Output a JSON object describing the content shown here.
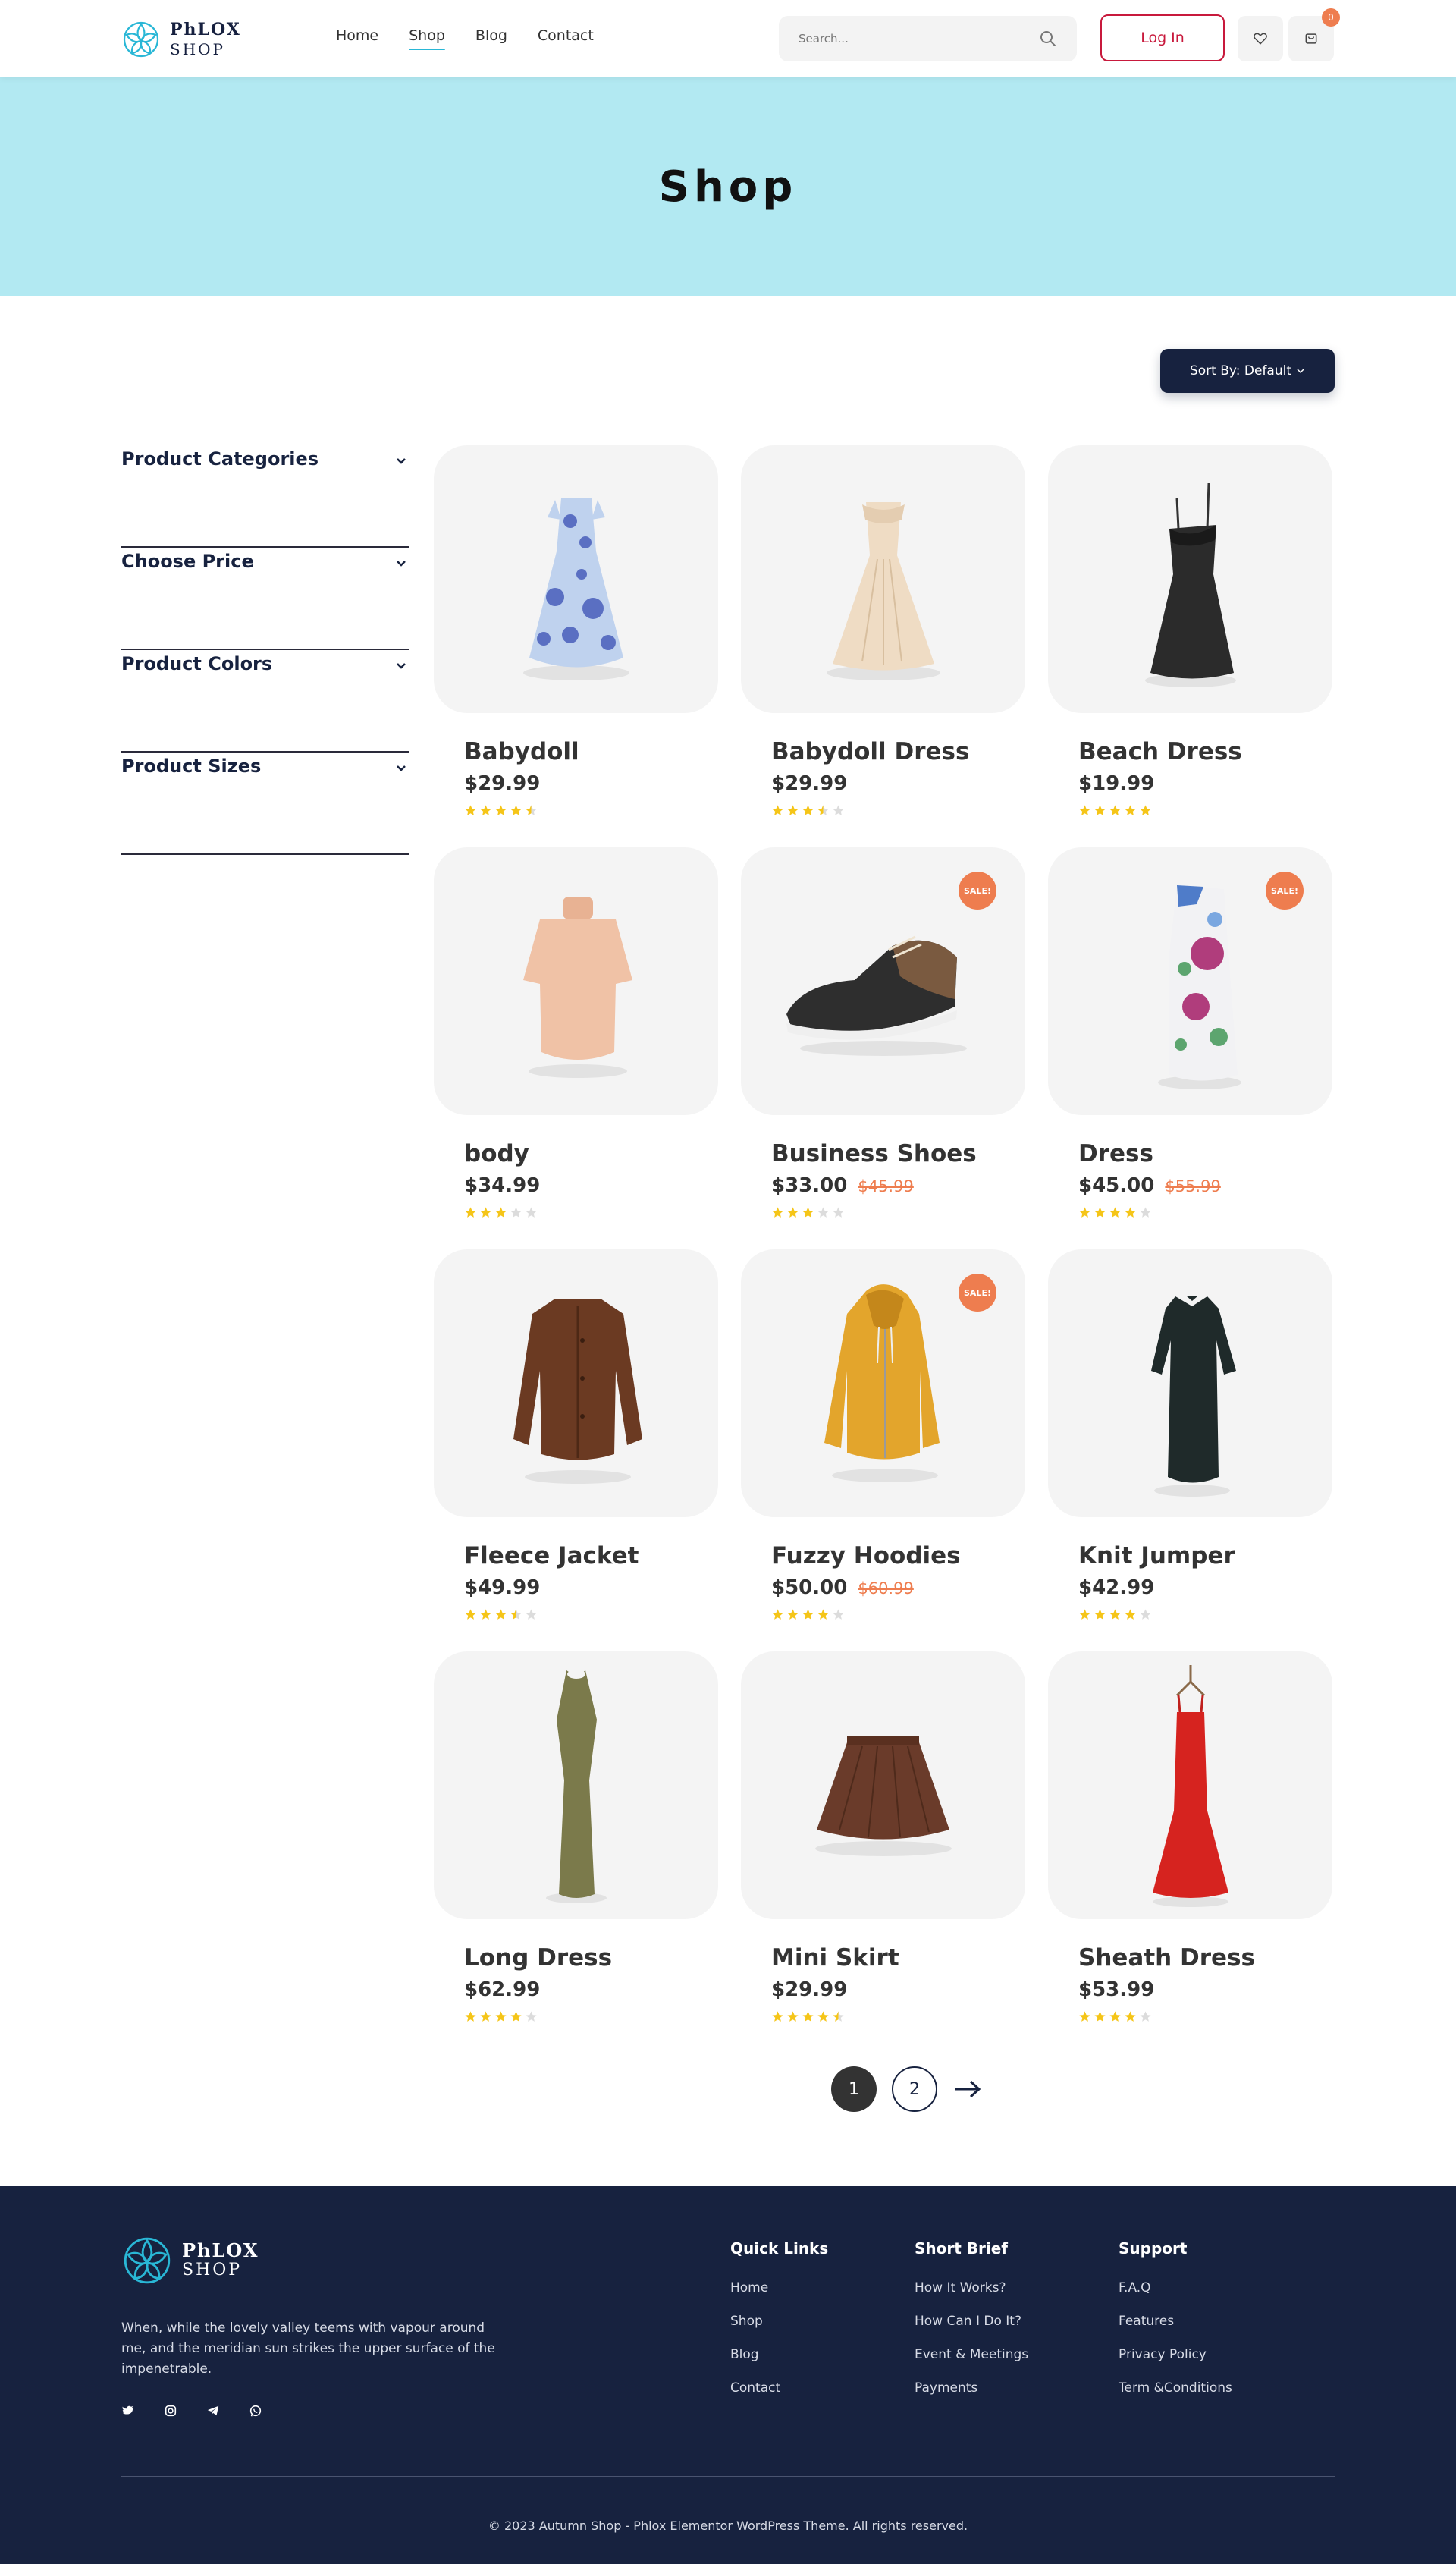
{
  "header": {
    "logo_line1": "PhLOX",
    "logo_line2": "SHOP",
    "nav": [
      "Home",
      "Shop",
      "Blog",
      "Contact"
    ],
    "active_nav": "Shop",
    "search_placeholder": "Search...",
    "login_label": "Log In",
    "cart_count": "0"
  },
  "hero": {
    "title": "Shop"
  },
  "sort": {
    "label": "Sort By: Default"
  },
  "filters": [
    "Product Categories",
    "Choose Price",
    "Product Colors",
    "Product Sizes"
  ],
  "products": [
    {
      "name": "Babydoll",
      "price": "$29.99",
      "old_price": "",
      "sale": "",
      "rating": 4.5,
      "icon": "floral-dress"
    },
    {
      "name": "Babydoll Dress",
      "price": "$29.99",
      "old_price": "",
      "sale": "",
      "rating": 3.5,
      "icon": "gown"
    },
    {
      "name": "Beach Dress",
      "price": "$19.99",
      "old_price": "",
      "sale": "",
      "rating": 5,
      "icon": "black-dress"
    },
    {
      "name": "body",
      "price": "$34.99",
      "old_price": "",
      "sale": "",
      "rating": 3,
      "icon": "turtleneck-top"
    },
    {
      "name": "Business Shoes",
      "price": "$33.00",
      "old_price": "$45.99",
      "sale": "SALE!",
      "rating": 3,
      "icon": "shoe"
    },
    {
      "name": "Dress",
      "price": "$45.00",
      "old_price": "$55.99",
      "sale": "SALE!",
      "rating": 4,
      "icon": "floral-one-shoulder-dress"
    },
    {
      "name": "Fleece Jacket",
      "price": "$49.99",
      "old_price": "",
      "sale": "",
      "rating": 3.5,
      "icon": "jacket"
    },
    {
      "name": "Fuzzy Hoodies",
      "price": "$50.00",
      "old_price": "$60.99",
      "sale": "SALE!",
      "rating": 4,
      "icon": "hoodie"
    },
    {
      "name": "Knit Jumper",
      "price": "$42.99",
      "old_price": "",
      "sale": "",
      "rating": 4,
      "icon": "knit-dress"
    },
    {
      "name": "Long Dress",
      "price": "$62.99",
      "old_price": "",
      "sale": "",
      "rating": 4,
      "icon": "long-dress"
    },
    {
      "name": "Mini Skirt",
      "price": "$29.99",
      "old_price": "",
      "sale": "",
      "rating": 4.5,
      "icon": "skirt"
    },
    {
      "name": "Sheath Dress",
      "price": "$53.99",
      "old_price": "",
      "sale": "",
      "rating": 4,
      "icon": "red-dress"
    }
  ],
  "pagination": {
    "pages": [
      "1",
      "2"
    ],
    "current": "1"
  },
  "footer": {
    "logo_line1": "PhLOX",
    "logo_line2": "SHOP",
    "description": "When, while the lovely valley teems with vapour around me, and the meridian sun strikes the upper surface of the impenetrable.",
    "socials": [
      "twitter-icon",
      "instagram-icon",
      "telegram-icon",
      "whatsapp-icon"
    ],
    "columns": [
      {
        "title": "Quick Links",
        "links": [
          "Home",
          "Shop",
          "Blog",
          "Contact"
        ]
      },
      {
        "title": "Short Brief",
        "links": [
          "How It Works?",
          "How Can I Do It?",
          "Event & Meetings",
          "Payments"
        ]
      },
      {
        "title": "Support",
        "links": [
          "F.A.Q",
          "Features",
          "Privacy Policy",
          "Term &Conditions"
        ]
      }
    ],
    "copyright": "© 2023 Autumn Shop - Phlox Elementor WordPress Theme. All rights reserved."
  },
  "colors": {
    "hero_bg": "#b2e9f2",
    "navy": "#17223f",
    "accent_red": "#c8193c",
    "sale_orange": "#ee7d4f",
    "star": "#f5c518",
    "nav_underline": "#29b7d6"
  }
}
